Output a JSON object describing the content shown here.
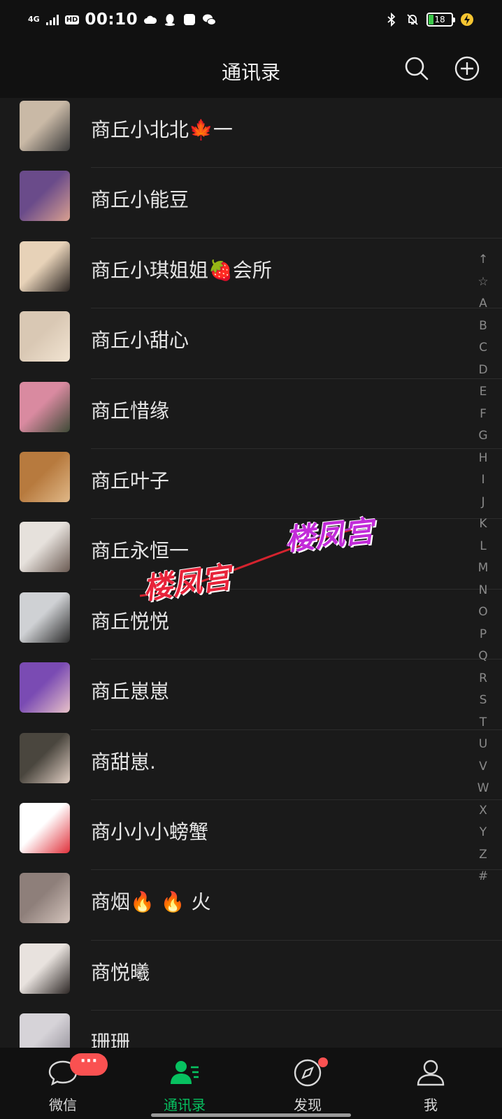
{
  "status_bar": {
    "network": "4G",
    "hd": "HD",
    "time": "00:10",
    "battery": "18"
  },
  "header": {
    "title": "通讯录"
  },
  "contacts": [
    {
      "name": "商丘小北北🍁一",
      "colors": [
        "#c9b9a6",
        "#3a3a3a"
      ]
    },
    {
      "name": "商丘小能豆",
      "colors": [
        "#6a4b8a",
        "#d9a090"
      ]
    },
    {
      "name": "商丘小琪姐姐🍓会所",
      "colors": [
        "#e7d2b8",
        "#2a2421"
      ]
    },
    {
      "name": "商丘小甜心",
      "colors": [
        "#d9c8b4",
        "#f2e4d2"
      ]
    },
    {
      "name": "商丘惜缘",
      "colors": [
        "#d98aa0",
        "#3e4a36"
      ]
    },
    {
      "name": "商丘叶子",
      "colors": [
        "#b77a3e",
        "#e0b888"
      ]
    },
    {
      "name": "商丘永恒一",
      "colors": [
        "#e6e1dc",
        "#6a5a52"
      ]
    },
    {
      "name": "商丘悦悦",
      "colors": [
        "#cfd1d4",
        "#2a2a2a"
      ]
    },
    {
      "name": "商丘崽崽",
      "colors": [
        "#7a4bb3",
        "#e8c2c8"
      ]
    },
    {
      "name": "商甜崽.",
      "colors": [
        "#4a463e",
        "#e1cfc4"
      ]
    },
    {
      "name": "商小小小螃蟹",
      "colors": [
        "#ffffff",
        "#e0303a"
      ]
    },
    {
      "name": "商烟🔥 🔥 火",
      "colors": [
        "#8e7f7a",
        "#d4c4bc"
      ]
    },
    {
      "name": "商悦曦",
      "colors": [
        "#e8e2de",
        "#2e2826"
      ]
    },
    {
      "name": "珊珊",
      "colors": [
        "#d6d3d8",
        "#8a8690"
      ]
    }
  ],
  "alphabet": [
    "↑",
    "☆",
    "A",
    "B",
    "C",
    "D",
    "E",
    "F",
    "G",
    "H",
    "I",
    "J",
    "K",
    "L",
    "M",
    "N",
    "O",
    "P",
    "Q",
    "R",
    "S",
    "T",
    "U",
    "V",
    "W",
    "X",
    "Y",
    "Z",
    "#"
  ],
  "watermark": {
    "text1": "楼凤宫",
    "text2": "楼凤宫"
  },
  "tabs": [
    {
      "label": "微信",
      "badge": "···"
    },
    {
      "label": "通讯录"
    },
    {
      "label": "发现"
    },
    {
      "label": "我"
    }
  ],
  "colors": {
    "accent": "#07c160",
    "badge": "#fa5151",
    "background": "#1a1a1a",
    "bar": "#111111"
  }
}
